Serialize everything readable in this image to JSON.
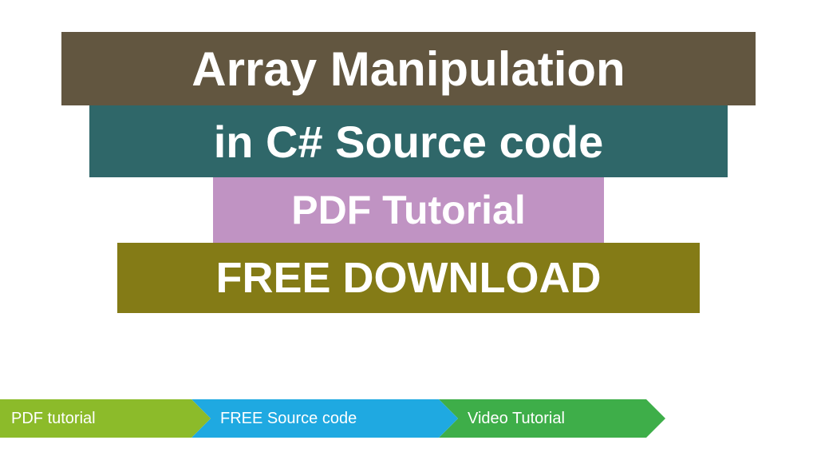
{
  "banner": {
    "line1": "Array Manipulation",
    "line2": "in C# Source code",
    "line3": "PDF Tutorial",
    "line4": "FREE DOWNLOAD"
  },
  "chevrons": [
    {
      "label": "PDF tutorial"
    },
    {
      "label": "FREE Source code"
    },
    {
      "label": "Video Tutorial"
    }
  ],
  "colors": {
    "bar1": "#625640",
    "bar2": "#2f6769",
    "bar3": "#c093c3",
    "bar4": "#847b16",
    "chev1": "#8cbb2a",
    "chev2": "#1fa9e1",
    "chev3": "#3eae49"
  }
}
